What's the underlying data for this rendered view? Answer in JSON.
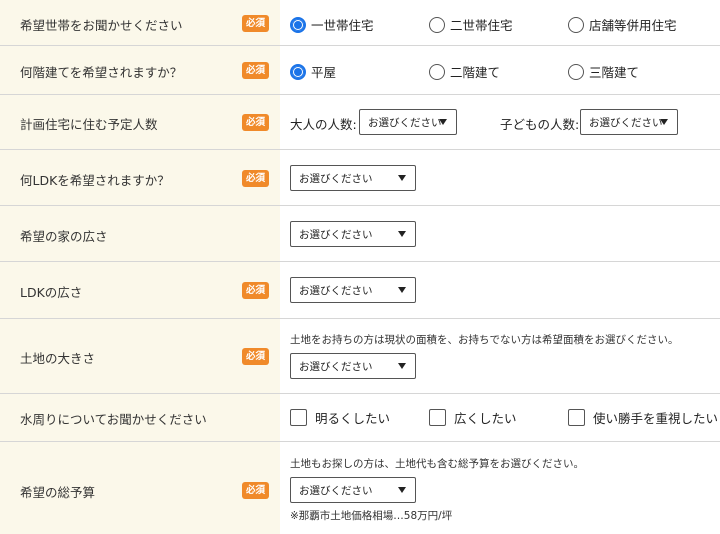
{
  "required_badge": "必須",
  "rows": {
    "household": {
      "label": "希望世帯をお聞かせください",
      "options": [
        "一世帯住宅",
        "二世帯住宅",
        "店舗等併用住宅"
      ],
      "selected": 0
    },
    "floors": {
      "label": "何階建てを希望されますか？",
      "options": [
        "平屋",
        "二階建て",
        "三階建て"
      ],
      "selected": 0
    },
    "residents": {
      "label": "計画住宅に住む予定人数",
      "adults_label": "大人の人数:",
      "children_label": "子どもの人数:",
      "adults_value": "お選びください",
      "children_value": "お選びください"
    },
    "ldk": {
      "label": "何LDKを希望されますか？",
      "value": "お選びください"
    },
    "house_size": {
      "label": "希望の家の広さ",
      "value": "お選びください"
    },
    "ldk_size": {
      "label": "LDKの広さ",
      "value": "お選びください"
    },
    "land_size": {
      "label": "土地の大きさ",
      "note": "土地をお持ちの方は現状の面積を、お持ちでない方は希望面積をお選びください。",
      "value": "お選びください"
    },
    "water": {
      "label": "水周りについてお聞かせください",
      "options": [
        "明るくしたい",
        "広くしたい",
        "使い勝手を重視したい"
      ]
    },
    "budget": {
      "label": "希望の総予算",
      "note": "土地もお探しの方は、土地代も含む総予算をお選びください。",
      "value": "お選びください",
      "sub_note": "※那覇市土地価格相場…58万円/坪"
    }
  },
  "colors": {
    "label_bg": "#fbf8ea",
    "required_badge": "#f08a2a",
    "radio_checked": "#1a73e8"
  }
}
